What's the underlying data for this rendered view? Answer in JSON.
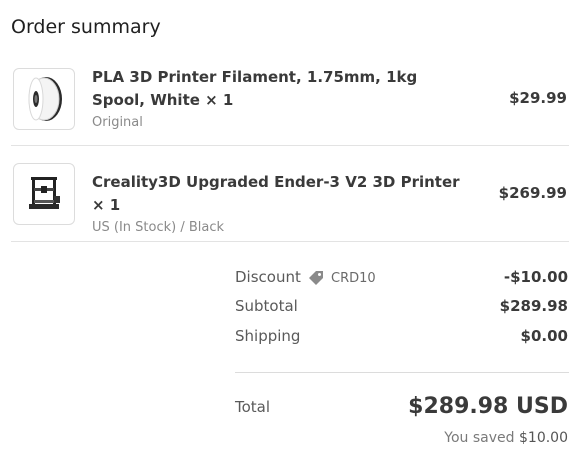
{
  "title": "Order summary",
  "items": [
    {
      "name": "PLA 3D Printer Filament, 1.75mm, 1kg Spool, White × 1",
      "variant": "Original",
      "price": "$29.99",
      "image_icon": "filament-spool-icon"
    },
    {
      "name": "Creality3D Upgraded Ender-3 V2 3D Printer × 1",
      "variant": "US (In Stock) / Black",
      "price": "$269.99",
      "image_icon": "3d-printer-icon"
    }
  ],
  "summary": {
    "discount_label": "Discount",
    "discount_code": "CRD10",
    "discount_value": "-$10.00",
    "subtotal_label": "Subtotal",
    "subtotal_value": "$289.98",
    "shipping_label": "Shipping",
    "shipping_value": "$0.00",
    "total_label": "Total",
    "total_value": "$289.98 USD",
    "saved_label": "You saved",
    "saved_value": "$10.00"
  },
  "colors": {
    "text_primary": "#3a3a3a",
    "text_secondary": "#8a8a8a",
    "border": "#e3e3e3"
  }
}
